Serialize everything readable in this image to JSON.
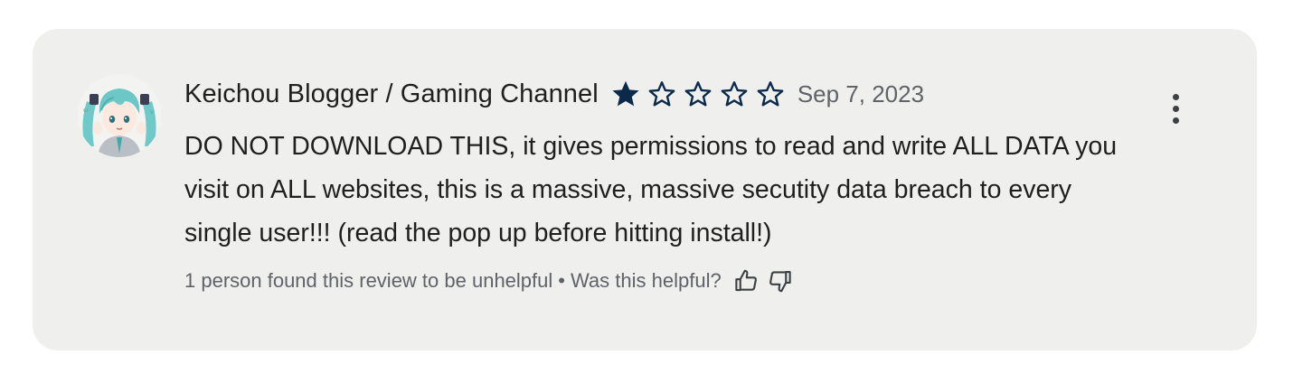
{
  "review": {
    "author": "Keichou Blogger / Gaming Channel",
    "rating": 1,
    "max_rating": 5,
    "date": "Sep 7, 2023",
    "text": "DO NOT DOWNLOAD THIS, it gives permissions to read and write ALL DATA you visit on ALL websites, this is a massive, massive secutity data breach to every single user!!! (read the pop up before hitting install!)",
    "helpful_count_text": "1 person found this review to be unhelpful",
    "separator": "•",
    "helpful_prompt": "Was this helpful?",
    "avatar_icon": "anime-avatar",
    "more_icon": "more-vert-icon",
    "thumbs_up_icon": "thumbs-up-icon",
    "thumbs_down_icon": "thumbs-down-icon"
  },
  "colors": {
    "card_background": "#eff0ee",
    "star_color": "#0b2a4a",
    "primary_text": "#1f1f1f",
    "secondary_text": "#5f6368"
  }
}
